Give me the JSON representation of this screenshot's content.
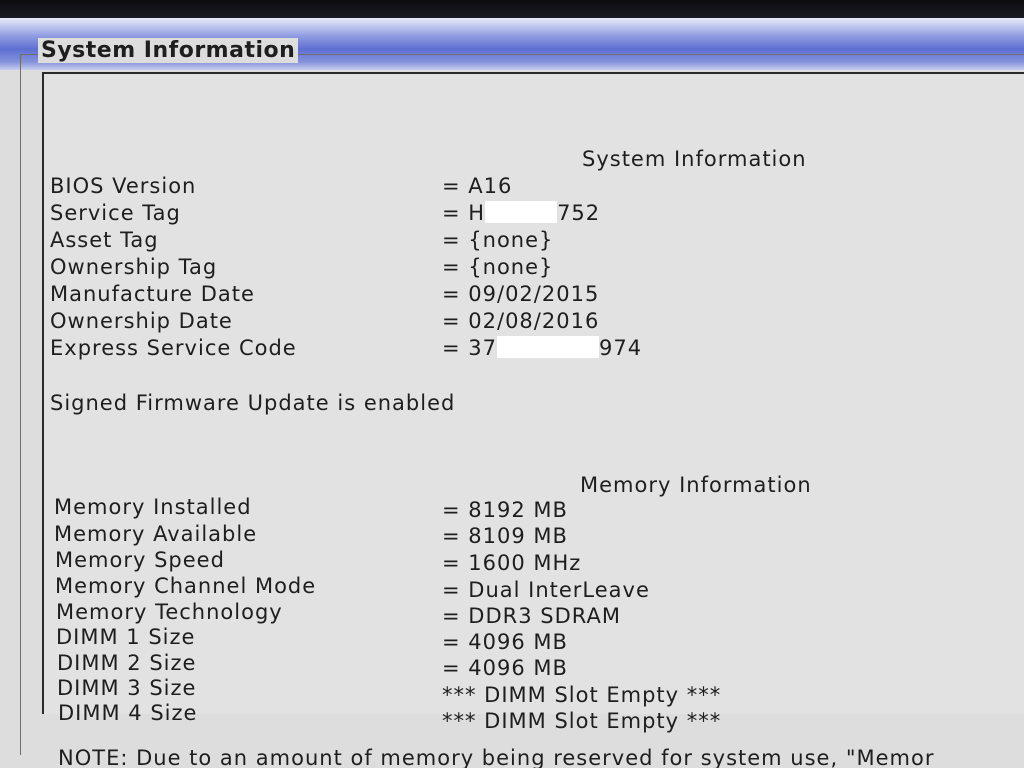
{
  "group_title": "System Information",
  "system": {
    "heading": "System Information",
    "rows": [
      {
        "label": "BIOS Version",
        "value": "= A16"
      },
      {
        "label": "Service Tag",
        "value_prefix": "= H",
        "value_suffix": "752"
      },
      {
        "label": "Asset Tag",
        "value": "= {none}"
      },
      {
        "label": "Ownership Tag",
        "value": "= {none}"
      },
      {
        "label": "Manufacture Date",
        "value": "= 09/02/2015"
      },
      {
        "label": "Ownership Date",
        "value": "= 02/08/2016"
      },
      {
        "label": "Express Service Code",
        "value_prefix": "= 37",
        "value_suffix": "974"
      }
    ],
    "firmware_note": "Signed Firmware Update is enabled"
  },
  "memory": {
    "heading": "Memory Information",
    "rows": [
      {
        "label": "Memory Installed",
        "value": "= 8192 MB"
      },
      {
        "label": "Memory Available",
        "value": "= 8109 MB"
      },
      {
        "label": "Memory Speed",
        "value": "= 1600 MHz"
      },
      {
        "label": "Memory Channel Mode",
        "value": "= Dual InterLeave"
      },
      {
        "label": "Memory Technology",
        "value": "= DDR3 SDRAM"
      },
      {
        "label": "DIMM 1 Size",
        "value": "= 4096 MB"
      },
      {
        "label": "DIMM 2 Size",
        "value": "= 4096 MB"
      },
      {
        "label": "DIMM 3 Size",
        "value": "*** DIMM Slot Empty ***"
      },
      {
        "label": "DIMM 4 Size",
        "value": "*** DIMM Slot Empty ***"
      }
    ]
  },
  "note": "NOTE: Due to an amount of memory being reserved for system use, \"Memor"
}
